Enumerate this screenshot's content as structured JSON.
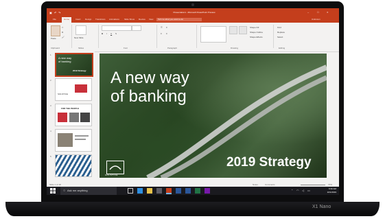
{
  "window": {
    "title": "Presentation1 - Microsoft PowerPoint Preview",
    "user": "Unknown"
  },
  "ribbon_tabs": [
    "File",
    "Home",
    "Insert",
    "Design",
    "Transitions",
    "Animations",
    "Slide Show",
    "Review",
    "View"
  ],
  "active_tab": "Home",
  "tell_me": "Tell me what you want to do",
  "ribbon": {
    "paste": "Paste",
    "new_slide": "New Slide",
    "groups": [
      "Clipboard",
      "Slides",
      "Font",
      "Paragraph",
      "Drawing",
      "Editing"
    ],
    "shape_fill": "Shape Fill",
    "shape_outline": "Shape Outline",
    "shape_effects": "Shape Effects",
    "find": "Find",
    "replace": "Replace",
    "select": "Select"
  },
  "thumbnails": [
    {
      "num": "1",
      "line1": "A new way",
      "line2": "of banking",
      "line3": "2019 Strategy"
    },
    {
      "num": "2",
      "line1": "SOLSTICE"
    },
    {
      "num": "3",
      "line1": "FOR THE PEOPLE"
    },
    {
      "num": "4",
      "line1": ""
    },
    {
      "num": "5",
      "line1": ""
    }
  ],
  "slide": {
    "title_line1": "A new way",
    "title_line2": "of banking",
    "subtitle": "2019 Strategy",
    "logo_text": "SOLSTICE"
  },
  "statusbar": {
    "slide_of": "Slide 1 of 18",
    "notes": "Notes",
    "comments": "Comments",
    "zoom": "70%"
  },
  "taskbar": {
    "search_placeholder": "Ask me anything",
    "time": "6:30 AM",
    "date": "10/1/2019"
  },
  "device_brand": "X1 Nano",
  "colors": {
    "accent": "#c43e1c",
    "taskbar": "#1a1a1f"
  }
}
